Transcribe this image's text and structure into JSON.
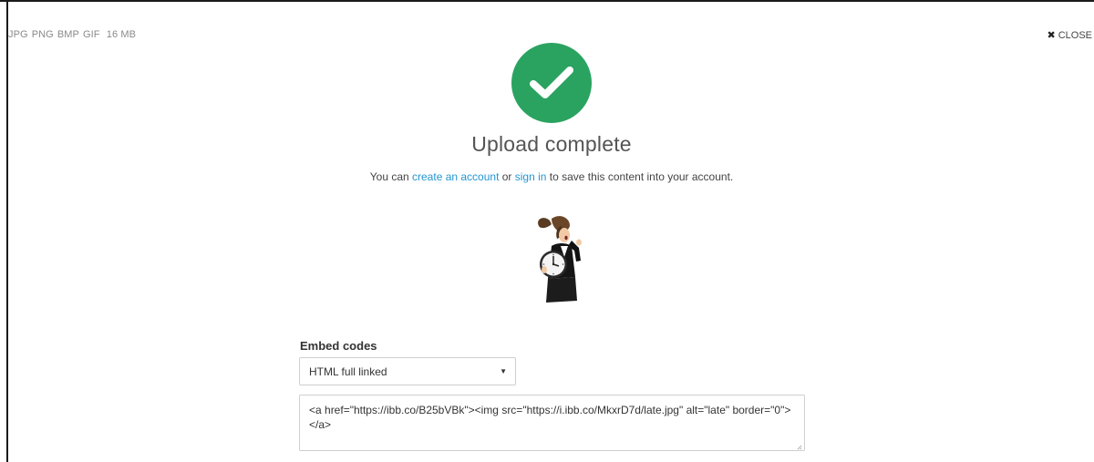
{
  "header": {
    "formats": [
      "JPG",
      "PNG",
      "BMP",
      "GIF"
    ],
    "max_size": "16 MB",
    "close_label": "CLOSE"
  },
  "status": {
    "title": "Upload complete",
    "message_prefix": "You can ",
    "create_account_link": "create an account",
    "message_middle": " or ",
    "sign_in_link": "sign in",
    "message_suffix": " to save this content into your account."
  },
  "embed": {
    "label": "Embed codes",
    "selected_option": "HTML full linked",
    "code": "<a href=\"https://ibb.co/B25bVBk\"><img src=\"https://i.ibb.co/MkxrD7d/late.jpg\" alt=\"late\" border=\"0\"></a>"
  },
  "colors": {
    "success": "#2aa361",
    "link": "#2496d1"
  },
  "icons": {
    "close": "close-icon",
    "check": "check-icon",
    "dropdown": "chevron-down-icon"
  }
}
